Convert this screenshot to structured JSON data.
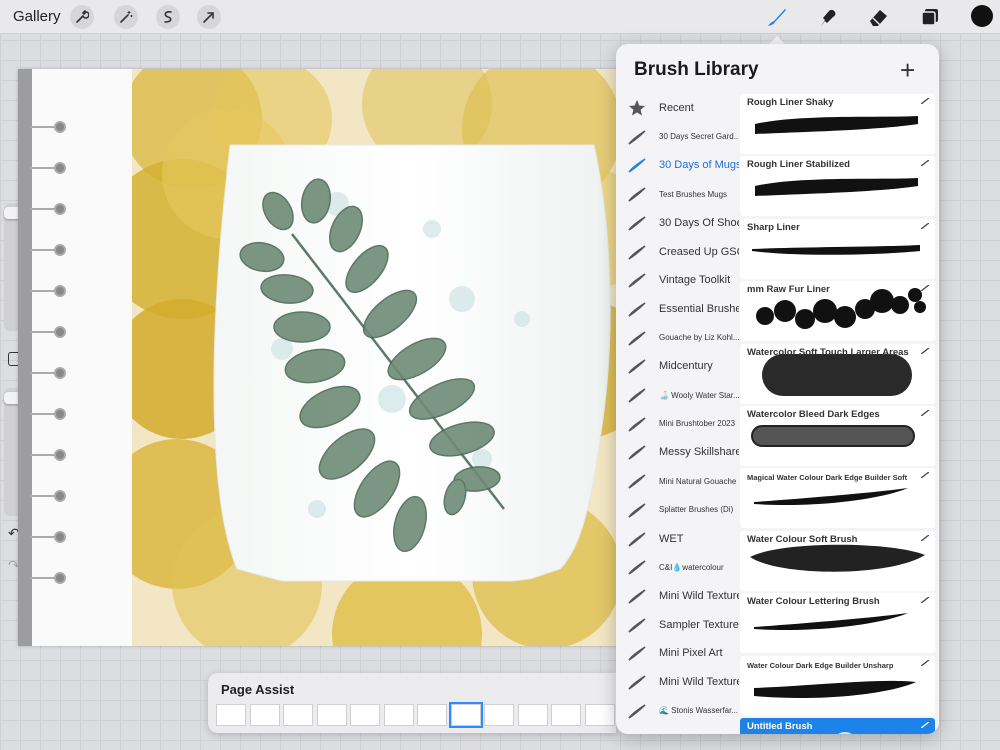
{
  "toolbar": {
    "gallery_label": "Gallery",
    "left_tools": [
      "wrench-icon",
      "magic-wand-icon",
      "selection-icon",
      "transform-arrow-icon"
    ],
    "right_tools": [
      "brush-icon",
      "smudge-icon",
      "eraser-icon",
      "layers-icon"
    ],
    "active_tool": "brush-icon",
    "current_color": "#111111"
  },
  "brush_library": {
    "title": "Brush Library",
    "add_symbol": "+",
    "sets": [
      {
        "label": "Recent",
        "size": "big",
        "icon": "star-icon"
      },
      {
        "label": "30 Days Secret Gard...",
        "size": "small"
      },
      {
        "label": "30 Days of Mugs",
        "size": "big",
        "active": true
      },
      {
        "label": "Test Brushes Mugs",
        "size": "small"
      },
      {
        "label": "30 Days Of Shoes",
        "size": "big"
      },
      {
        "label": "Creased Up GSC",
        "size": "big"
      },
      {
        "label": "Vintage Toolkit",
        "size": "big"
      },
      {
        "label": "Essential Brushes",
        "size": "big"
      },
      {
        "label": "Gouache by Liz Kohl...",
        "size": "small"
      },
      {
        "label": "Midcentury",
        "size": "big"
      },
      {
        "label": "🍶 Wooly Water Star...",
        "size": "small"
      },
      {
        "label": "Mini Brushtober 2023",
        "size": "small"
      },
      {
        "label": "Messy Skillshare",
        "size": "big"
      },
      {
        "label": "Mini Natural Gouache",
        "size": "small"
      },
      {
        "label": "Splatter Brushes (Di)",
        "size": "small"
      },
      {
        "label": "WET",
        "size": "big"
      },
      {
        "label": "C&I💧watercolour",
        "size": "small"
      },
      {
        "label": "Mini Wild Textures",
        "size": "big"
      },
      {
        "label": "Sampler Texture",
        "size": "big"
      },
      {
        "label": "Mini Pixel Art",
        "size": "big"
      },
      {
        "label": "Mini Wild Textures",
        "size": "big"
      },
      {
        "label": "🌊 Stonis Wasserfar...",
        "size": "small"
      }
    ],
    "brushes": [
      {
        "name": "Rough Liner Shaky",
        "stroke": "rough"
      },
      {
        "name": "Rough Liner Stabilized",
        "stroke": "rough"
      },
      {
        "name": "Sharp Liner",
        "stroke": "sharp"
      },
      {
        "name": "mm Raw Fur Liner",
        "stroke": "fur"
      },
      {
        "name": "Watercolor Soft Touch Larger Areas",
        "stroke": "soft"
      },
      {
        "name": "Watercolor Bleed Dark Edges",
        "stroke": "bleed"
      },
      {
        "name": "Magical Water Colour Dark Edge Builder Soft",
        "stroke": "taper",
        "tiny": true
      },
      {
        "name": "Water Colour Soft Brush",
        "stroke": "blob"
      },
      {
        "name": "Water Colour Lettering Brush",
        "stroke": "taper"
      },
      {
        "name": "Water Colour Dark Edge Builder Unsharp",
        "stroke": "taper2",
        "tiny": true
      },
      {
        "name": "Untitled Brush",
        "stroke": "cloud",
        "selected": true
      }
    ]
  },
  "page_assist": {
    "title": "Page Assist",
    "pages": 12,
    "selected_page": 8
  }
}
